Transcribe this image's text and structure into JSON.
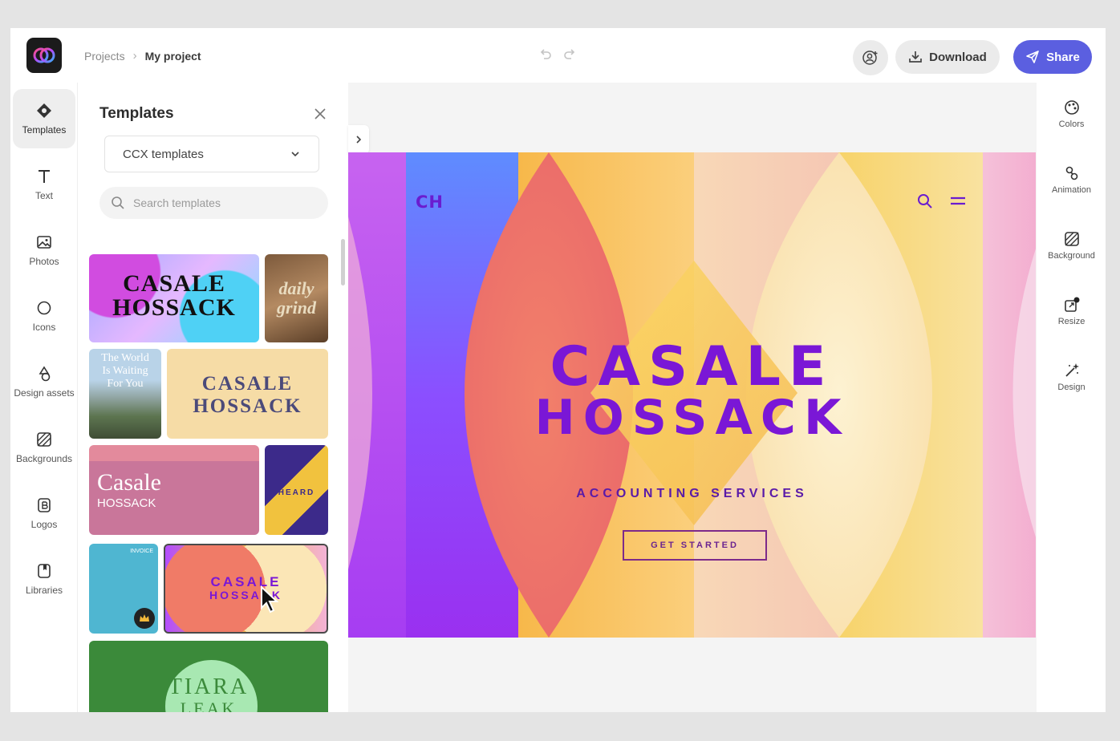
{
  "breadcrumb": {
    "parent": "Projects",
    "separator": "›",
    "current": "My project"
  },
  "toolbar": {
    "download_label": "Download",
    "share_label": "Share"
  },
  "left_rail": {
    "items": [
      {
        "label": "Templates",
        "icon": "templates-icon",
        "active": true
      },
      {
        "label": "Text",
        "icon": "text-icon"
      },
      {
        "label": "Photos",
        "icon": "photos-icon"
      },
      {
        "label": "Icons",
        "icon": "icons-icon"
      },
      {
        "label": "Design assets",
        "icon": "design-assets-icon"
      },
      {
        "label": "Backgrounds",
        "icon": "backgrounds-icon"
      },
      {
        "label": "Logos",
        "icon": "logos-icon"
      },
      {
        "label": "Libraries",
        "icon": "libraries-icon"
      }
    ]
  },
  "panel": {
    "title": "Templates",
    "dropdown_value": "CCX templates",
    "search_placeholder": "Search templates",
    "thumbs": {
      "t1_line1": "CASALE",
      "t1_line2": "HOSSACK",
      "t2_line1": "daily",
      "t2_line2": "grind",
      "t3_line1": "The World",
      "t3_line2": "Is Waiting",
      "t3_line3": "For You",
      "t4_line1": "CASALE",
      "t4_line2": "HOSSACK",
      "t5_line1": "Casale",
      "t5_line2": "HOSSACK",
      "t6_text": "HEARD",
      "t7_text": "INVOICE",
      "t8_line1": "CASALE",
      "t8_line2": "HOSSACK",
      "t9_line1": "TIARA",
      "t9_line2": "LEAK"
    }
  },
  "artboard": {
    "logo": "CH",
    "title_line1": "CASALE",
    "title_line2": "HOSSACK",
    "subtitle": "ACCOUNTING SERVICES",
    "button": "GET STARTED"
  },
  "right_rail": {
    "items": [
      {
        "label": "Colors",
        "icon": "colors-icon"
      },
      {
        "label": "Animation",
        "icon": "animation-icon"
      },
      {
        "label": "Background",
        "icon": "background-icon"
      },
      {
        "label": "Resize",
        "icon": "resize-icon"
      },
      {
        "label": "Design",
        "icon": "design-icon"
      }
    ]
  },
  "colors": {
    "accent": "#5b5fe0",
    "title_purple": "#7a17d6"
  }
}
